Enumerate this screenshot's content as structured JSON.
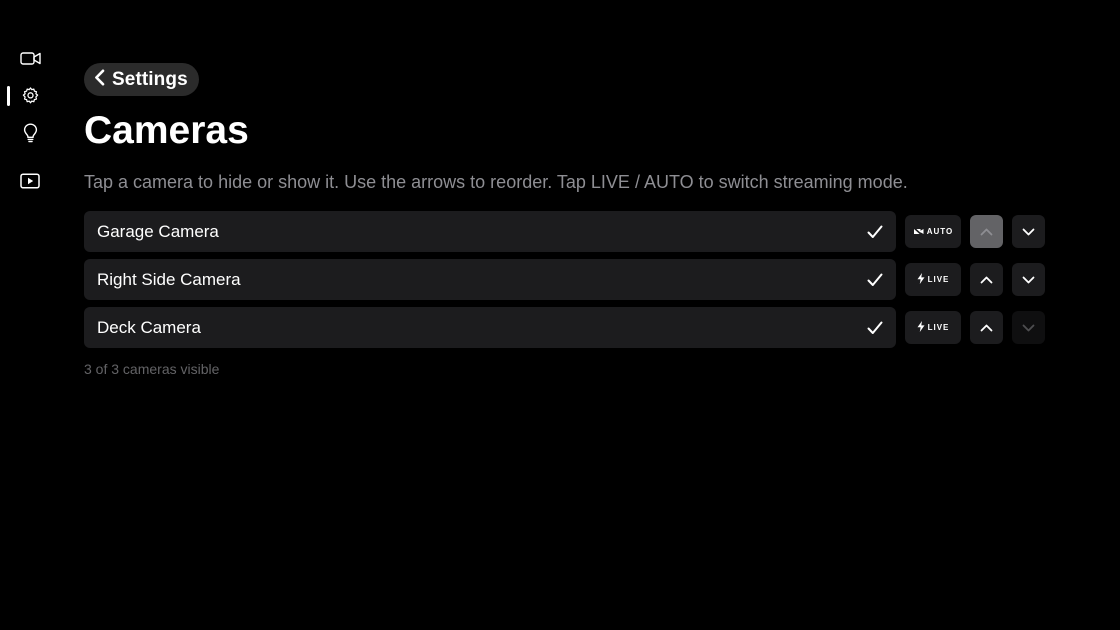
{
  "rail": {
    "items": [
      {
        "icon": "video-camera-icon"
      },
      {
        "icon": "gear-icon",
        "active": true
      },
      {
        "icon": "lightbulb-icon"
      },
      {
        "icon": "play-rectangle-icon"
      }
    ]
  },
  "header": {
    "back_label": "Settings",
    "title": "Cameras",
    "subtitle": "Tap a camera to hide or show it. Use the arrows to reorder. Tap LIVE / AUTO to switch streaming mode."
  },
  "cameras": [
    {
      "name": "Garage Camera",
      "visible": true,
      "mode": "AUTO",
      "mode_icon": "auto-stream-icon",
      "up_state": "focused-disabled",
      "down_state": "enabled"
    },
    {
      "name": "Right Side Camera",
      "visible": true,
      "mode": "LIVE",
      "mode_icon": "bolt-icon",
      "up_state": "enabled",
      "down_state": "enabled"
    },
    {
      "name": "Deck Camera",
      "visible": true,
      "mode": "LIVE",
      "mode_icon": "bolt-icon",
      "up_state": "enabled",
      "down_state": "disabled"
    }
  ],
  "footer": {
    "count_text": "3 of 3 cameras visible"
  },
  "colors": {
    "background": "#000000",
    "row": "#1c1c1e",
    "focused": "#636366",
    "secondary_text": "#8e8e93",
    "tertiary_text": "#636366"
  }
}
